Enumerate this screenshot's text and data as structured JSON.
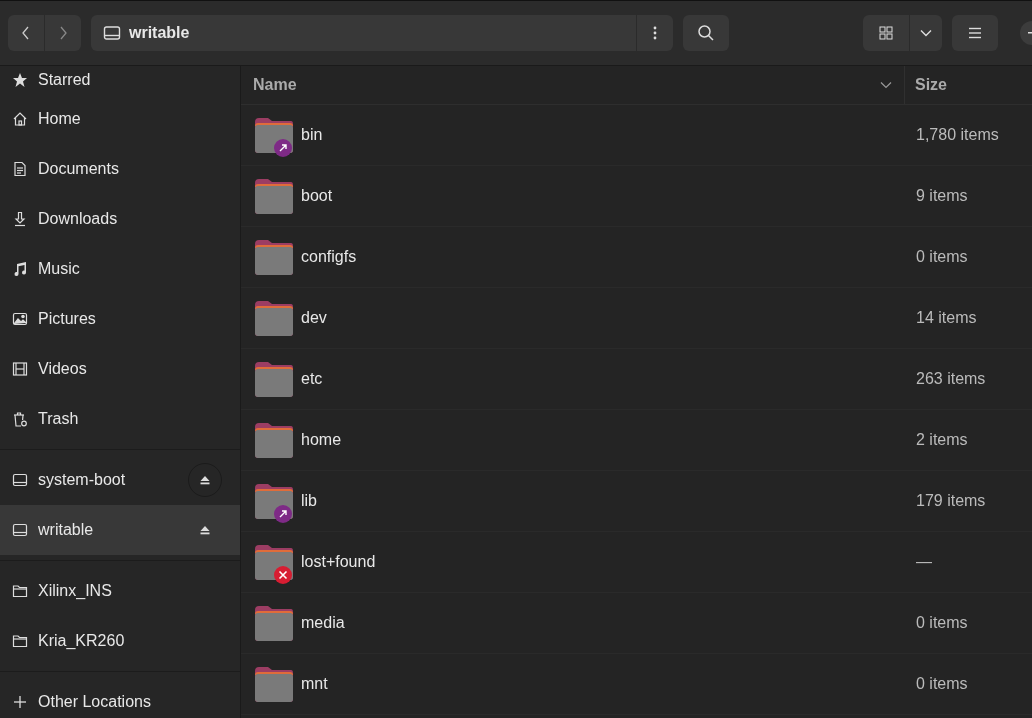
{
  "header": {
    "location": "writable"
  },
  "sidebar": {
    "sections": [
      {
        "items": [
          {
            "label": "Starred",
            "kind": "star",
            "selected": false
          },
          {
            "label": "Home",
            "kind": "home",
            "selected": false
          },
          {
            "label": "Documents",
            "kind": "document",
            "selected": false
          },
          {
            "label": "Downloads",
            "kind": "download",
            "selected": false
          },
          {
            "label": "Music",
            "kind": "music",
            "selected": false
          },
          {
            "label": "Pictures",
            "kind": "picture",
            "selected": false
          },
          {
            "label": "Videos",
            "kind": "video",
            "selected": false
          },
          {
            "label": "Trash",
            "kind": "trash",
            "selected": false
          }
        ]
      },
      {
        "items": [
          {
            "label": "system-boot",
            "kind": "drive",
            "selected": false,
            "ejectable": true
          },
          {
            "label": "writable",
            "kind": "drive",
            "selected": true,
            "ejectable": true
          }
        ]
      },
      {
        "items": [
          {
            "label": "Xilinx_INS",
            "kind": "folder",
            "selected": false
          },
          {
            "label": "Kria_KR260",
            "kind": "folder",
            "selected": false
          }
        ]
      },
      {
        "items": [
          {
            "label": "Other Locations",
            "kind": "plus",
            "selected": false
          }
        ]
      }
    ]
  },
  "table": {
    "columns": [
      {
        "label": "Name",
        "sorted": true
      },
      {
        "label": "Size",
        "sorted": false
      }
    ],
    "rows": [
      {
        "name": "bin",
        "size": "1,780 items",
        "kind": "symlink"
      },
      {
        "name": "boot",
        "size": "9 items",
        "kind": "folder"
      },
      {
        "name": "configfs",
        "size": "0 items",
        "kind": "folder"
      },
      {
        "name": "dev",
        "size": "14 items",
        "kind": "folder"
      },
      {
        "name": "etc",
        "size": "263 items",
        "kind": "folder"
      },
      {
        "name": "home",
        "size": "2 items",
        "kind": "folder"
      },
      {
        "name": "lib",
        "size": "179 items",
        "kind": "symlink"
      },
      {
        "name": "lost+found",
        "size": "—",
        "kind": "unreadable"
      },
      {
        "name": "media",
        "size": "0 items",
        "kind": "folder"
      },
      {
        "name": "mnt",
        "size": "0 items",
        "kind": "folder"
      }
    ]
  }
}
